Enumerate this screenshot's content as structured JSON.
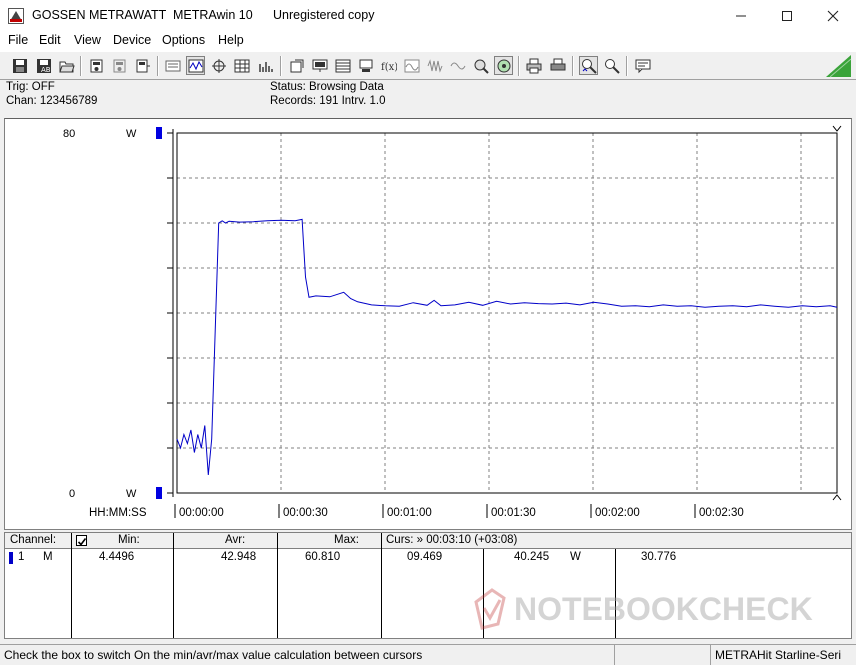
{
  "titlebar": {
    "vendor": "GOSSEN METRAWATT",
    "app": "METRAwin 10",
    "license": "Unregistered copy"
  },
  "menu": [
    "File",
    "Edit",
    "View",
    "Device",
    "Options",
    "Help"
  ],
  "info": {
    "trig": "Trig: OFF",
    "chan": "Chan:  123456789",
    "status": "Status:   Browsing Data",
    "records": "Records: 191   Intrv. 1.0"
  },
  "chart_data": {
    "type": "line",
    "title": "",
    "xlabel": "HH:MM:SS",
    "ylabel": "",
    "y_top_label": "80",
    "y_top_unit": "W",
    "y_bottom_label": "0",
    "y_bottom_unit": "W",
    "ylim": [
      0,
      80
    ],
    "xlim_seconds": [
      0,
      190
    ],
    "grid": true,
    "x_tick_labels": [
      "00:00:00",
      "00:00:30",
      "00:01:00",
      "00:01:30",
      "00:02:00",
      "00:02:30"
    ],
    "series": [
      {
        "color": "#0000c8",
        "x_seconds": [
          0,
          1,
          2,
          3,
          4,
          5,
          6,
          7,
          8,
          9,
          10,
          11,
          12,
          13,
          14,
          15,
          18,
          22,
          26,
          30,
          34,
          36,
          37,
          38,
          40,
          44,
          48,
          50,
          52,
          56,
          60,
          64,
          68,
          72,
          74,
          76,
          80,
          84,
          88,
          92,
          96,
          100,
          104,
          108,
          112,
          116,
          120,
          124,
          128,
          132,
          136,
          140,
          144,
          148,
          152,
          156,
          160,
          164,
          168,
          172,
          176,
          180,
          184,
          188,
          190
        ],
        "values": [
          12,
          10,
          13,
          11,
          14,
          9,
          13,
          10,
          15,
          4,
          12,
          36,
          60,
          60.5,
          60,
          60.4,
          60.2,
          60.3,
          60.5,
          60.6,
          60.5,
          60.8,
          48,
          43.5,
          43.8,
          43.6,
          44.6,
          43.2,
          42.5,
          41.8,
          41.6,
          41.5,
          42.3,
          41.7,
          42.8,
          41.6,
          41.8,
          42.4,
          41.7,
          42.6,
          42.0,
          42.3,
          42.1,
          42.0,
          42.2,
          41.8,
          42.4,
          42.0,
          41.5,
          41.6,
          41.4,
          41.8,
          41.5,
          41.6,
          41.3,
          41.5,
          41.6,
          41.4,
          41.8,
          41.5,
          41.3,
          41.6,
          41.4,
          41.6,
          41.3
        ]
      }
    ]
  },
  "table": {
    "headers": {
      "channel": "Channel:",
      "min": "Min:",
      "avr": "Avr:",
      "max": "Max:",
      "curs": "Curs: » 00:03:10 (+03:08)"
    },
    "row": {
      "num": "1",
      "mode": "M",
      "min": "4.4496",
      "avr": "42.948",
      "max": "60.810",
      "c1": "09.469",
      "c2": "40.245",
      "unit": "W",
      "c3": "30.776"
    }
  },
  "statusbar": {
    "message": "Check the box to switch On the min/avr/max value calculation between cursors",
    "model": "METRAHit Starline-Seri"
  },
  "watermark": "NOTEBOOKCHECK"
}
